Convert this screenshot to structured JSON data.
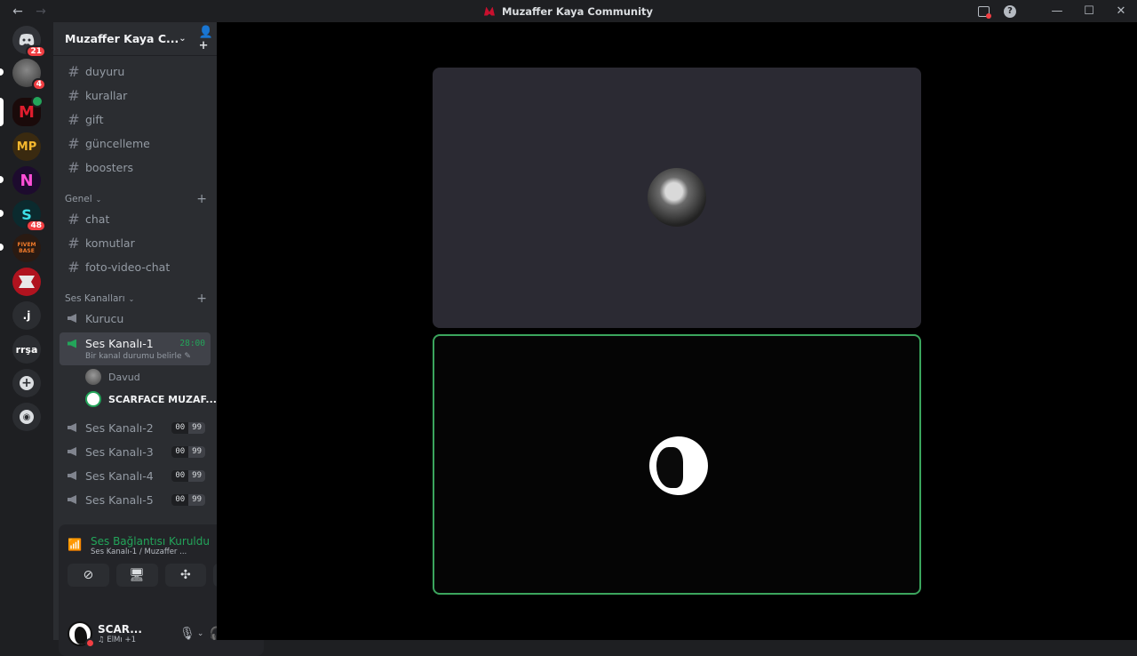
{
  "window": {
    "title": "Muzaffer Kaya Community",
    "back_glyph": "←",
    "forward_glyph": "→",
    "help_glyph": "?",
    "minimize_glyph": "—",
    "maximize_glyph": "☐",
    "close_glyph": "✕"
  },
  "guilds": [
    {
      "label": "",
      "badge": "21",
      "icon": "discord-icon"
    },
    {
      "label": "",
      "badge": "4",
      "icon": "avatar"
    },
    {
      "label": "M",
      "badge": "",
      "icon": "muzaffer-server-icon"
    },
    {
      "label": "MP",
      "badge": "",
      "icon": "mp-server-icon"
    },
    {
      "label": "N",
      "badge": "",
      "icon": "n-server-icon"
    },
    {
      "label": "S",
      "badge": "48",
      "icon": "s-server-icon"
    },
    {
      "label": "FIVEM BASE",
      "badge": "",
      "icon": "fivem-base-icon"
    },
    {
      "label": "",
      "badge": "",
      "icon": "red-server-icon"
    },
    {
      "label": ".j",
      "badge": "",
      "icon": "j-server-icon"
    },
    {
      "label": "rrşa",
      "badge": "",
      "icon": "rrsa-server-icon"
    },
    {
      "label": "+",
      "badge": "",
      "icon": "add-server-icon"
    },
    {
      "label": "◉",
      "badge": "",
      "icon": "discover-icon"
    }
  ],
  "server": {
    "name": "Muzaffer Kaya C...",
    "chevron": "⌄",
    "invite_glyph": "👤+"
  },
  "channels_top": [
    "duyuru",
    "kurallar",
    "gift",
    "güncelleme",
    "boosters"
  ],
  "category_genel": {
    "name": "Genel",
    "chevron": "⌄",
    "plus": "+"
  },
  "channels_genel": [
    "chat",
    "komutlar",
    "foto-video-chat"
  ],
  "category_voice": {
    "name": "Ses Kanalları",
    "chevron": "⌄",
    "plus": "+"
  },
  "voice": {
    "kurucu": "Kurucu",
    "active": {
      "name": "Ses Kanalı-1",
      "timer": "28:00",
      "status": "Bir kanal durumu belirle ✎"
    },
    "members": [
      "Davud",
      "SCARFACE MUZAF..."
    ],
    "others": [
      {
        "name": "Ses Kanalı-2",
        "a": "00",
        "b": "99"
      },
      {
        "name": "Ses Kanalı-3",
        "a": "00",
        "b": "99"
      },
      {
        "name": "Ses Kanalı-4",
        "a": "00",
        "b": "99"
      },
      {
        "name": "Ses Kanalı-5",
        "a": "00",
        "b": "99"
      }
    ]
  },
  "voice_panel": {
    "title": "Ses Bağlantısı Kuruldu",
    "subtitle": "Ses Kanalı-1 / Muzaffer ...",
    "signal_glyph": "📶",
    "soundboard_glyph": "⫼",
    "disconnect_glyph": "☎",
    "btn_camera": "⊘",
    "btn_screen": "🖥",
    "btn_activity": "✣",
    "btn_effects": "✧"
  },
  "user": {
    "name": "SCAR...",
    "sub": "♫ ElMı +1",
    "mic_glyph": "🎙",
    "headset_glyph": "🎧",
    "settings_glyph": "⚙",
    "chev": "⌄"
  }
}
